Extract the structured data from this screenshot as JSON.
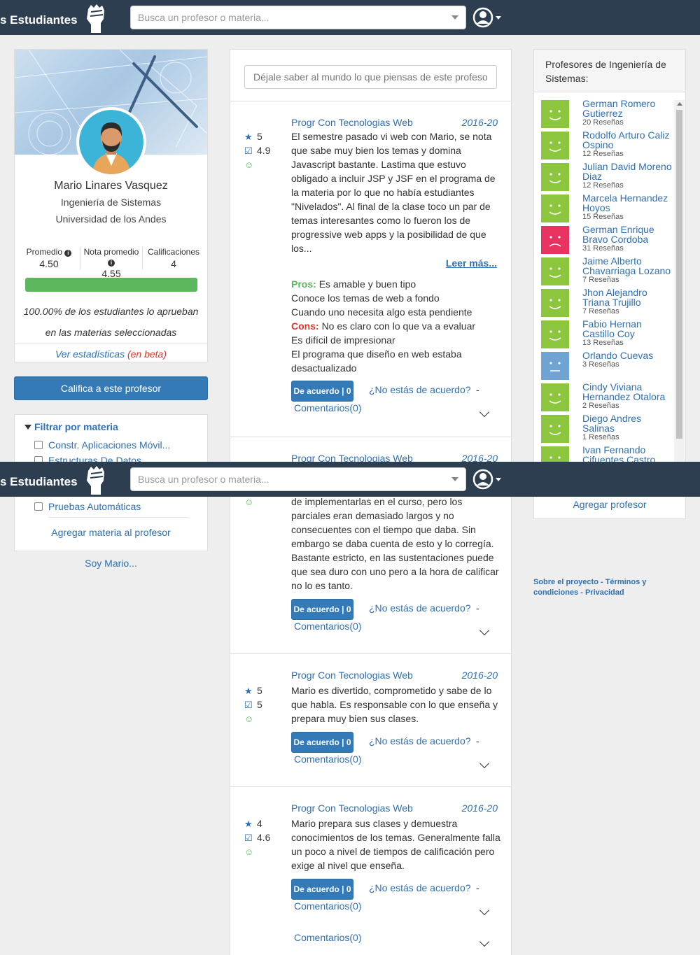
{
  "navbar": {
    "brand": "s Estudiantes",
    "search_placeholder": "Busca un profesor o materia..."
  },
  "profile": {
    "name": "Mario Linares Vasquez",
    "department": "Ingeniería de Sistemas",
    "university": "Universidad de los Andes",
    "stats": [
      {
        "label": "Promedio",
        "value": "4.50",
        "info": true
      },
      {
        "label": "Nota promedio",
        "value": "4.55",
        "info": true
      },
      {
        "label": "Calificaciones",
        "value": "4",
        "info": false
      }
    ],
    "approval_fraction": 1.0,
    "approval_line1": "100.00% de los estudiantes lo aprueban",
    "approval_line2": "en las materias seleccionadas",
    "stats_link": "Ver estadísticas",
    "beta": "(en beta)"
  },
  "rate_button": "Califica a este profesor",
  "filter": {
    "title": "Filtrar por materia",
    "items": [
      "Constr. Aplicaciones Móvil...",
      "Estructuras De Datos",
      "Pruebas Automáticas"
    ],
    "add_label": "Agregar materia al profesor"
  },
  "soy": "Soy Mario...",
  "feed": {
    "comment_placeholder": "Déjale saber al mundo lo que piensas de este profeso",
    "reviews": [
      {
        "course": "Progr Con Tecnologias Web",
        "term": "2016-20",
        "rating": "5",
        "grade": "4.9",
        "text": "El semestre pasado vi web con Mario, se nota que sabe muy bien los temas y domina Javascript bastante. Lastima que estuvo obligado a incluir JSP y JSF en el programa de la materia por lo que no había estudiantes \"Nivelados\". Al final de la clase toco un par de temas interesantes como lo fueron los de progressive web apps y la posibilidad de que los...",
        "read_more": "Leer más...",
        "pros_label": "Pros:",
        "pros": [
          "Es amable y buen tipo",
          "Conoce los temas de web a fondo",
          "Cuando uno necesita algo esta pendiente"
        ],
        "cons_label": "Cons:",
        "cons": [
          "No es claro con lo que va a evaluar",
          "Es difícil de impresionar",
          "El programa que diseño en web estaba desactualizado"
        ],
        "agree": "De acuerdo | 0",
        "disagree": "¿No estás de acuerdo?",
        "comments": "Comentarios(0)"
      },
      {
        "course": "Progr Con Tecnologias Web",
        "term": "2016-20",
        "text": "de implementarlas en el curso, pero los parciales eran demasiado largos y no consecuentes con el tiempo que daba. Sin embargo se daba cuenta de esto y lo corregía. Bastante estricto, en las sustentaciones puede que sea duro con uno pero a la hora de calificar no lo es tanto.",
        "agree": "De acuerdo | 0",
        "disagree": "¿No estás de acuerdo?",
        "comments": "Comentarios(0)"
      },
      {
        "course": "Progr Con Tecnologias Web",
        "term": "2016-20",
        "rating": "5",
        "grade": "5",
        "text": "Mario es divertido, comprometido y sabe de lo que habla. Es responsable con lo que enseña y prepara muy bien sus clases.",
        "agree": "De acuerdo | 0",
        "disagree": "¿No estás de acuerdo?",
        "comments": "Comentarios(0)"
      },
      {
        "course": "Progr Con Tecnologias Web",
        "term": "2016-20",
        "rating": "4",
        "grade": "4.6",
        "text": "Mario prepara sus clases y demuestra conocimientos de los temas. Generalmente falla un poco a nivel de tiempos de calificación pero exige al nivel que enseña.",
        "agree": "De acuerdo | 0",
        "disagree": "¿No estás de acuerdo?",
        "comments": "Comentarios(0)",
        "extra_comments": "Comentarios(0)"
      }
    ]
  },
  "sidebar": {
    "title": "Profesores de Ingeniería de Sistemas:",
    "professors": [
      {
        "name": "German Romero Gutierrez",
        "reviews": "20 Reseñas",
        "mood": "happy",
        "color": "#8cc63f"
      },
      {
        "name": "Rodolfo Arturo Caliz Ospino",
        "reviews": "12 Reseñas",
        "mood": "happy",
        "color": "#8cc63f"
      },
      {
        "name": "Julian David Moreno Diaz",
        "reviews": "12 Reseñas",
        "mood": "happy",
        "color": "#8cc63f"
      },
      {
        "name": "Marcela Hernandez Hoyos",
        "reviews": "15 Reseñas",
        "mood": "happy",
        "color": "#8cc63f"
      },
      {
        "name": "German Enrique Bravo Cordoba",
        "reviews": "31 Reseñas",
        "mood": "sad",
        "color": "#e8325f"
      },
      {
        "name": "Jaime Alberto Chavarriaga Lozano",
        "reviews": "7 Reseñas",
        "mood": "happy",
        "color": "#8cc63f"
      },
      {
        "name": "Jhon Alejandro Triana Trujillo",
        "reviews": "7 Reseñas",
        "mood": "happy",
        "color": "#8cc63f"
      },
      {
        "name": "Fabio Hernan Castillo Coy",
        "reviews": "13 Reseñas",
        "mood": "happy",
        "color": "#8cc63f"
      },
      {
        "name": "Orlando Cuevas",
        "reviews": "3 Reseñas",
        "mood": "neutral",
        "color": "#6fa3d2"
      },
      {
        "name": "Cindy Viviana Hernandez Otalora",
        "reviews": "2 Reseñas",
        "mood": "happy",
        "color": "#8cc63f"
      },
      {
        "name": "Diego Andres Salinas",
        "reviews": "1 Reseñas",
        "mood": "happy",
        "color": "#8cc63f"
      },
      {
        "name": "Ivan Fernando Cifuentes Castro",
        "reviews": "",
        "mood": "happy",
        "color": "#8cc63f"
      }
    ],
    "add_label": "Agregar profesor"
  },
  "footer": {
    "about": "Sobre el proyecto",
    "terms": "Términos y condiciones",
    "privacy": "Privacidad"
  },
  "colors": {
    "navbar": "#2c3e50",
    "primary": "#337ab7",
    "link": "#2f6fb3",
    "success": "#5cb85c",
    "danger": "#d9372b"
  }
}
